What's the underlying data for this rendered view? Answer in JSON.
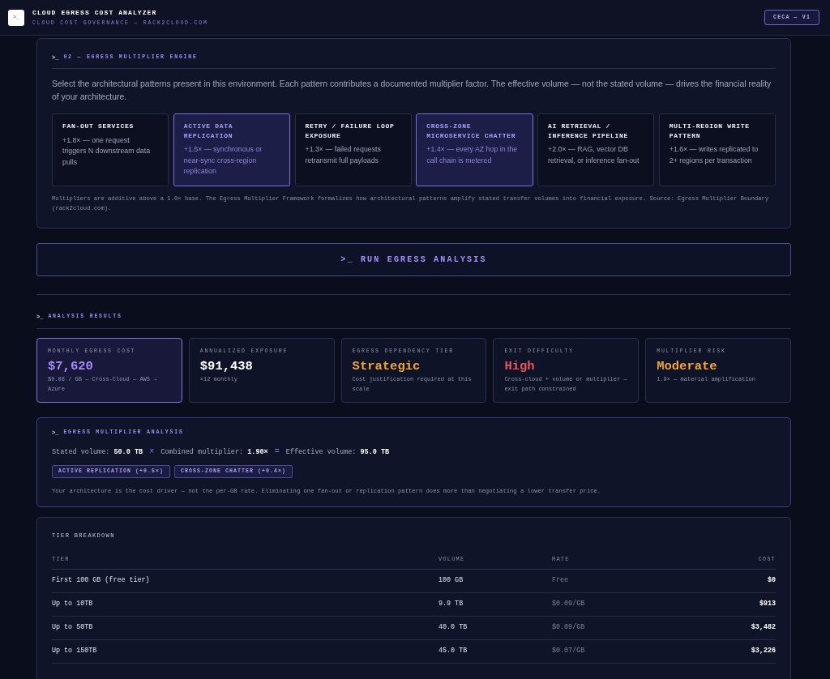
{
  "header": {
    "logo": ">_",
    "title": "CLOUD EGRESS COST ANALYZER",
    "subtitle": "CLOUD COST GOVERNANCE — RACK2CLOUD.COM",
    "badge": "CECA — V1"
  },
  "multiplier_engine": {
    "prompt": ">_",
    "heading": "02 — EGRESS MULTIPLIER ENGINE",
    "intro": "Select the architectural patterns present in this environment. Each pattern contributes a documented multiplier factor. The effective volume — not the stated volume — drives the financial reality of your architecture.",
    "patterns": [
      {
        "title": "FAN-OUT SERVICES",
        "description": "+1.8× — one request triggers N downstream data pulls",
        "selected": false
      },
      {
        "title": "ACTIVE DATA REPLICATION",
        "description": "+1.5× — synchronous or near-sync cross-region replication",
        "selected": true
      },
      {
        "title": "RETRY / FAILURE LOOP EXPOSURE",
        "description": "+1.3× — failed requests retransmit full payloads",
        "selected": false
      },
      {
        "title": "CROSS-ZONE MICROSERVICE CHATTER",
        "description": "+1.4× — every AZ hop in the call chain is metered",
        "selected": true
      },
      {
        "title": "AI RETRIEVAL / INFERENCE PIPELINE",
        "description": "+2.0× — RAG, vector DB retrieval, or inference fan-out",
        "selected": false
      },
      {
        "title": "MULTI-REGION WRITE PATTERN",
        "description": "+1.6× — writes replicated to 2+ regions per transaction",
        "selected": false
      }
    ],
    "footnote": "Multipliers are additive above a 1.0× base. The Egress Multiplier Framework formalizes how architectural patterns amplify stated transfer volumes into financial exposure. Source: Egress Multiplier Boundary (rack2cloud.com)."
  },
  "run_button": ">_ RUN EGRESS ANALYSIS",
  "results": {
    "prompt": ">_",
    "heading": "ANALYSIS RESULTS",
    "metrics": [
      {
        "label": "MONTHLY EGRESS COST",
        "value": "$7,620",
        "detail": "$0.08 / GB — Cross-Cloud — AWS → Azure",
        "highlighted": true,
        "color": "#a78bfa"
      },
      {
        "label": "ANNUALIZED EXPOSURE",
        "value": "$91,438",
        "detail": "×12 monthly",
        "highlighted": false,
        "color": "#ffffff"
      },
      {
        "label": "EGRESS DEPENDENCY TIER",
        "value": "Strategic",
        "detail": "Cost justification required at this scale",
        "highlighted": false,
        "color": "#f0a43c"
      },
      {
        "label": "EXIT DIFFICULTY",
        "value": "High",
        "detail": "Cross-cloud + volume or multiplier — exit path constrained",
        "highlighted": false,
        "color": "#e5575a"
      },
      {
        "label": "MULTIPLIER RISK",
        "value": "Moderate",
        "detail": "1.9× — material amplification",
        "highlighted": false,
        "color": "#f0a43c"
      }
    ]
  },
  "multiplier_analysis": {
    "prompt": ">_",
    "heading": "EGRESS MULTIPLIER ANALYSIS",
    "equation": [
      {
        "kind": "label",
        "text": "Stated volume:"
      },
      {
        "kind": "value",
        "text": "50.0 TB"
      },
      {
        "kind": "operator",
        "text": "×"
      },
      {
        "kind": "label",
        "text": "Combined multiplier:"
      },
      {
        "kind": "value",
        "text": "1.90×"
      },
      {
        "kind": "operator",
        "text": "="
      },
      {
        "kind": "label",
        "text": "Effective volume:"
      },
      {
        "kind": "value",
        "text": "95.0 TB"
      }
    ],
    "tags": [
      "ACTIVE REPLICATION (+0.5×)",
      "CROSS-ZONE CHATTER (+0.4×)"
    ],
    "note": "Your architecture is the cost driver — not the per-GB rate. Eliminating one fan-out or replication pattern does more than negotiating a lower transfer price."
  },
  "tier_breakdown": {
    "title": "TIER BREAKDOWN",
    "columns": [
      "TIER",
      "VOLUME",
      "RATE",
      "COST"
    ],
    "rows": [
      [
        "First 100 GB (free tier)",
        "100 GB",
        "Free",
        "$0"
      ],
      [
        "Up to 10TB",
        "9.9 TB",
        "$0.09/GB",
        "$913"
      ],
      [
        "Up to 50TB",
        "40.0 TB",
        "$0.09/GB",
        "$3,482"
      ],
      [
        "Up to 150TB",
        "45.0 TB",
        "$0.07/GB",
        "$3,226"
      ]
    ]
  }
}
